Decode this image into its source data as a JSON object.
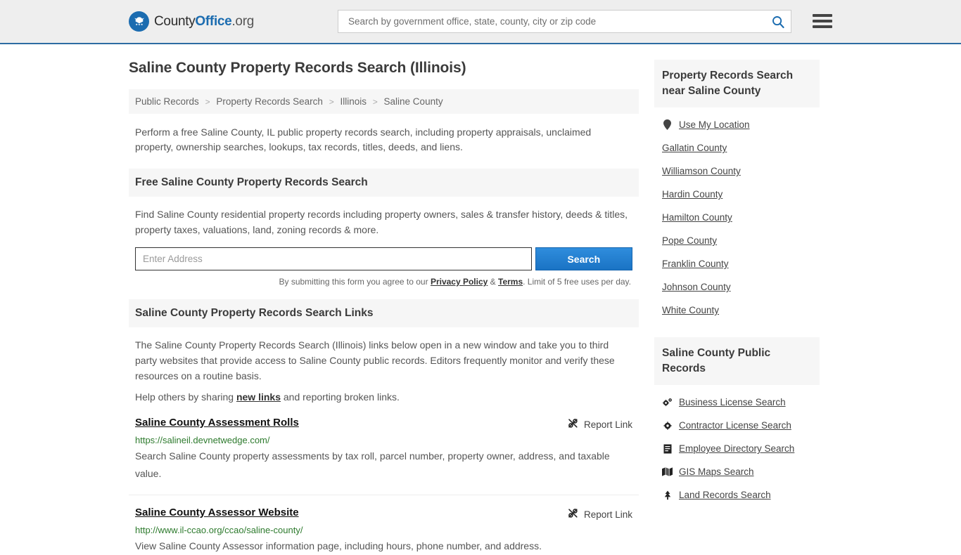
{
  "header": {
    "logo_name": "County",
    "logo_bold": "Office",
    "logo_tld": ".org",
    "search_placeholder": "Search by government office, state, county, city or zip code",
    "search_value": ""
  },
  "page_title": "Saline County Property Records Search (Illinois)",
  "breadcrumb": [
    "Public Records",
    "Property Records Search",
    "Illinois",
    "Saline County"
  ],
  "breadcrumb_sep": ">",
  "intro": "Perform a free Saline County, IL public property records search, including property appraisals, unclaimed property, ownership searches, lookups, tax records, titles, deeds, and liens.",
  "free_search": {
    "heading": "Free Saline County Property Records Search",
    "description": "Find Saline County residential property records including property owners, sales & transfer history, deeds & titles, property taxes, valuations, land, zoning records & more.",
    "input_placeholder": "Enter Address",
    "input_value": "",
    "button_label": "Search",
    "disclaimer_prefix": "By submitting this form you agree to our ",
    "privacy_label": "Privacy Policy",
    "disclaimer_amp": " & ",
    "terms_label": "Terms",
    "disclaimer_suffix": ". Limit of 5 free uses per day."
  },
  "links_section": {
    "heading": "Saline County Property Records Search Links",
    "paragraph": "The Saline County Property Records Search (Illinois) links below open in a new window and take you to third party websites that provide access to Saline County public records. Editors frequently monitor and verify these resources on a routine basis.",
    "help_prefix": "Help others by sharing ",
    "help_link": "new links",
    "help_suffix": " and reporting broken links.",
    "report_label": "Report Link",
    "results": [
      {
        "title": "Saline County Assessment Rolls",
        "url": "https://salineil.devnetwedge.com/",
        "description": "Search Saline County property assessments by tax roll, parcel number, property owner, address, and taxable value."
      },
      {
        "title": "Saline County Assessor Website",
        "url": "http://www.il-ccao.org/ccao/saline-county/",
        "description": "View Saline County Assessor information page, including hours, phone number, and address."
      }
    ]
  },
  "sidebar": {
    "near_heading": "Property Records Search near Saline County",
    "use_my_location": "Use My Location",
    "counties": [
      "Gallatin County",
      "Williamson County",
      "Hardin County",
      "Hamilton County",
      "Pope County",
      "Franklin County",
      "Johnson County",
      "White County"
    ],
    "public_records_heading": "Saline County Public Records",
    "public_records": [
      {
        "label": "Business License Search",
        "icon": "cogs-icon"
      },
      {
        "label": "Contractor License Search",
        "icon": "gear-icon"
      },
      {
        "label": "Employee Directory Search",
        "icon": "book-icon"
      },
      {
        "label": "GIS Maps Search",
        "icon": "map-icon"
      },
      {
        "label": "Land Records Search",
        "icon": "tree-icon"
      }
    ]
  },
  "colors": {
    "brand_blue": "#1b6cb0",
    "header_border": "#2d6ca2",
    "button_blue": "#1a73c4",
    "url_green": "#2d7a2d",
    "panel_gray": "#f6f6f6"
  }
}
